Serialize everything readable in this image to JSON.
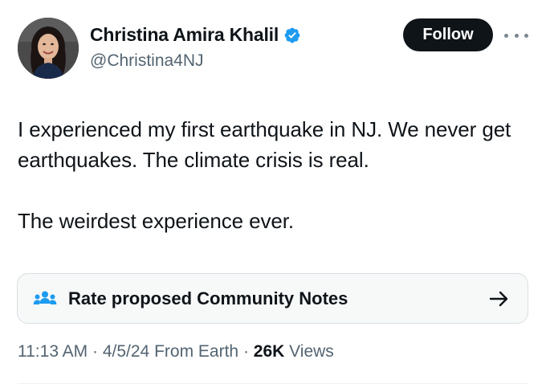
{
  "author": {
    "display_name": "Christina Amira Khalil",
    "handle": "@Christina4NJ",
    "verified_color": "#1d9bf0"
  },
  "header": {
    "follow_label": "Follow",
    "more_icon": "more-horizontal-icon"
  },
  "tweet": {
    "paragraphs": [
      "I experienced my first earthquake in NJ. We never get earthquakes. The climate crisis is real.",
      "The weirdest experience ever."
    ]
  },
  "community_notes": {
    "label": "Rate proposed Community Notes",
    "icon": "people-icon",
    "arrow_icon": "arrow-right-icon",
    "icon_color": "#1d9bf0"
  },
  "meta": {
    "time": "11:13 AM",
    "separator": " · ",
    "date": "4/5/24",
    "source": "From Earth",
    "views_count": "26K",
    "views_label": "Views"
  },
  "colors": {
    "text_primary": "#0f1419",
    "text_secondary": "#536471",
    "button_bg": "#0f1419",
    "card_bg": "#f7f9f9",
    "card_border": "#d8dee3"
  }
}
